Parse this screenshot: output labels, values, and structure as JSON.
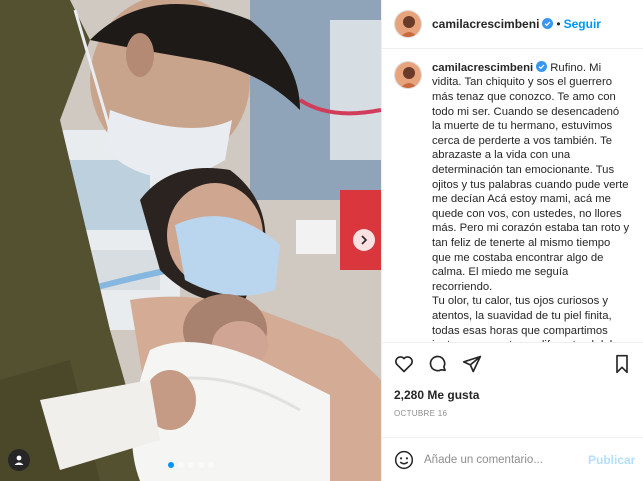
{
  "post": {
    "username": "camilacrescimbeni",
    "follow_label": "Seguir",
    "separator": "•",
    "caption": "Rufino. Mi vidita. Tan chiquito y sos el guerrero más tenaz que conozco. Te amo con todo mi ser. Cuando se desencadenó la muerte de tu hermano, estuvimos cerca de perderte a vos también. Te abrazaste a la vida con una determinación tan emocionante. Tus ojitos y tus palabras cuando pude verte me decían Acá estoy mami, acá me quede con vos, con ustedes, no llores más. Pero mi corazón estaba tan roto y tan feliz de tenerte al mismo tiempo que me costaba encontrar algo de calma. El miedo me seguía recorriendo.\nTu olor, tu calor, tus ojos curiosos y atentos, la suavidad de tu piel finita, todas esas horas que compartimos juntos en un entorno diferente al del",
    "likes": "2,280 Me gusta",
    "date": "OCTUBRE 16",
    "comment_placeholder": "Añade un comentario...",
    "publish_label": "Publicar",
    "carousel": {
      "count": 5,
      "active_index": 0
    }
  },
  "icons": {
    "verified": "verified-badge-icon",
    "like": "heart-icon",
    "comment": "comment-icon",
    "share": "paper-plane-icon",
    "save": "bookmark-icon",
    "emoji": "emoji-icon",
    "next": "chevron-right-icon",
    "tag": "user-tag-icon"
  },
  "colors": {
    "link": "#0095f6",
    "publish_disabled": "#b2dffc",
    "text": "#262626",
    "muted": "#8e8e8e",
    "border": "#efefef"
  }
}
